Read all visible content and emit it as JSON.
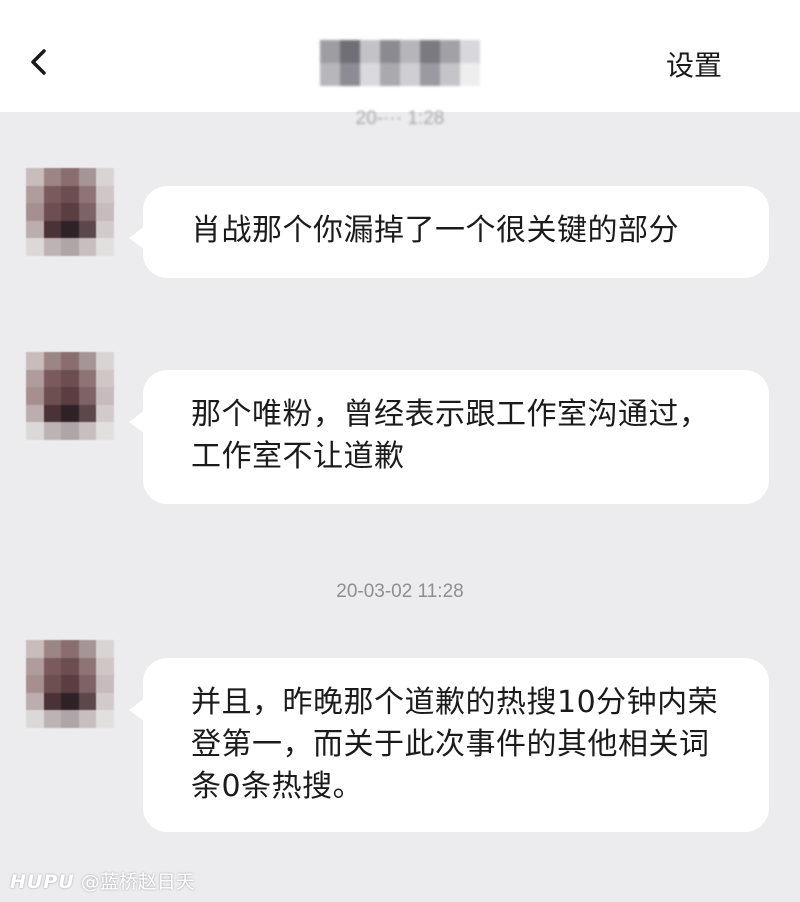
{
  "header": {
    "back_icon": "chevron-left-icon",
    "title": "",
    "settings_label": "设置"
  },
  "timestamps": {
    "top": "20-··· 1:28",
    "middle": "20-03-02 11:28"
  },
  "messages": [
    {
      "text": "肖战那个你漏掉了一个很关键的部分"
    },
    {
      "text": "那个唯粉，曾经表示跟工作室沟通过，工作室不让道歉"
    },
    {
      "text": "并且，昨晚那个道歉的热搜10分钟内荣登第一，而关于此次事件的其他相关词条0条热搜。"
    }
  ],
  "watermark": {
    "brand": "HUPU",
    "handle": "@蓝桥赵日天"
  }
}
